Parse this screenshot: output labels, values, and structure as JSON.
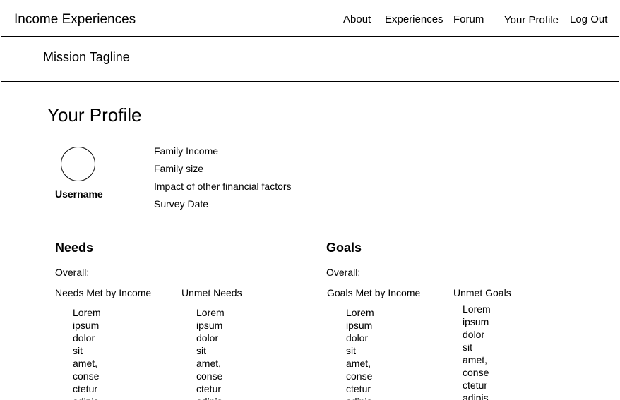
{
  "header": {
    "brand": "Income Experiences",
    "nav": {
      "about": "About",
      "experiences": "Experiences",
      "forum": "Forum",
      "profile": "Your Profile",
      "logout": "Log Out"
    }
  },
  "tagline": "Mission Tagline",
  "profile": {
    "title": "Your Profile",
    "username": "Username",
    "stats": {
      "income": "Family Income",
      "size": "Family size",
      "impact": "Impact of other financial factors",
      "date": "Survey Date"
    }
  },
  "needs": {
    "title": "Needs",
    "overall": "Overall:",
    "met_heading": "Needs Met by Income",
    "unmet_heading": "Unmet Needs",
    "met_items": [
      "Lorem",
      "ipsum",
      "dolor",
      "sit",
      "amet,",
      "conse",
      "ctetur",
      "adipis"
    ],
    "unmet_items": [
      "Lorem",
      "ipsum",
      "dolor",
      "sit",
      "amet,",
      "conse",
      "ctetur",
      "adipis"
    ]
  },
  "goals": {
    "title": "Goals",
    "overall": "Overall:",
    "met_heading": "Goals Met by Income",
    "unmet_heading": "Unmet Goals",
    "met_items": [
      "Lorem",
      "ipsum",
      "dolor",
      "sit",
      "amet,",
      "conse",
      "ctetur",
      "adipis"
    ],
    "unmet_items": [
      "Lorem",
      "ipsum",
      "dolor",
      "sit",
      "amet,",
      "conse",
      "ctetur",
      "adipis"
    ]
  }
}
